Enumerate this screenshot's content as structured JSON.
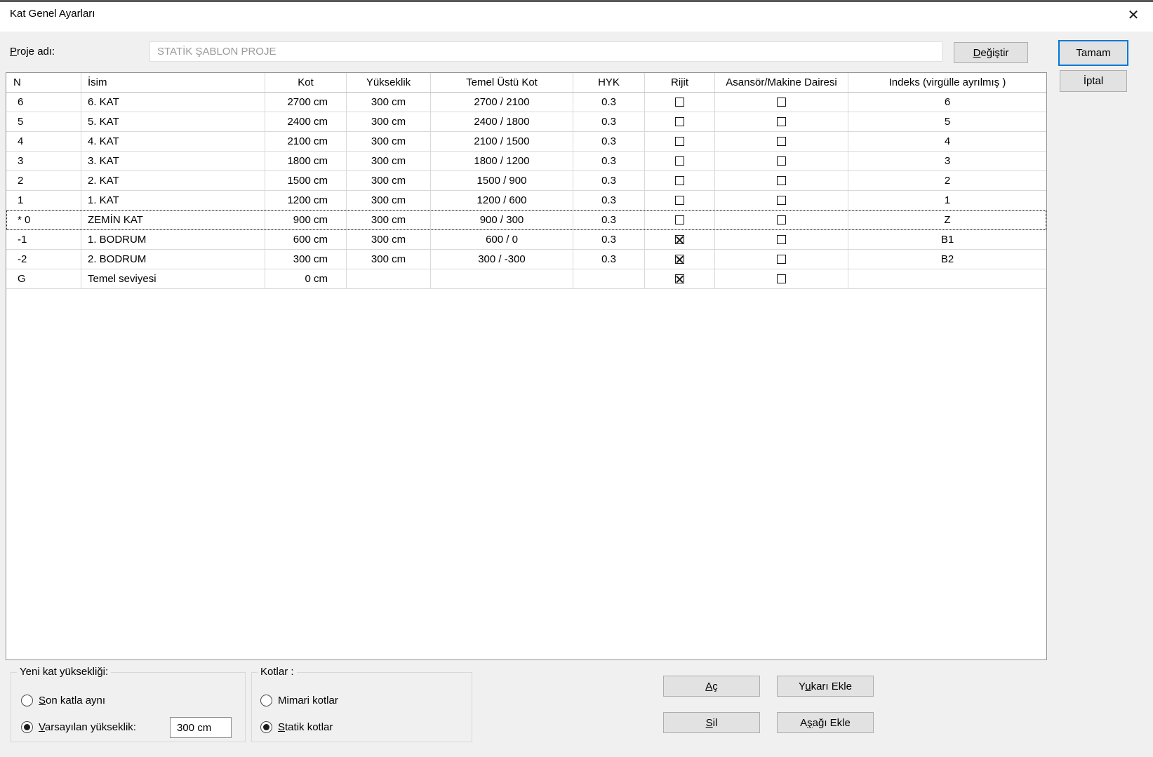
{
  "dialog": {
    "title": "Kat Genel Ayarları"
  },
  "icons": {
    "close": "✕"
  },
  "project": {
    "label": {
      "pre": "",
      "key": "P",
      "post": "roje adı:"
    },
    "value": "STATİK ŞABLON PROJE",
    "change_button": {
      "pre": "",
      "key": "D",
      "post": "eğiştir"
    }
  },
  "actions": {
    "ok": "Tamam",
    "cancel": "İptal"
  },
  "table": {
    "headers": [
      "N",
      "İsim",
      "Kot",
      "Yükseklik",
      "Temel Üstü Kot",
      "HYK",
      "Rijit",
      "Asansör/Makine Dairesi",
      "Indeks (virgülle ayrılmış )"
    ],
    "rows": [
      {
        "n": "6",
        "isim": "6. KAT",
        "kot": "2700 cm",
        "yukseklik": "300 cm",
        "temel": "2700 / 2100",
        "hyk": "0.3",
        "rijit": false,
        "asansor": false,
        "indeks": "6",
        "selected": false
      },
      {
        "n": "5",
        "isim": "5. KAT",
        "kot": "2400 cm",
        "yukseklik": "300 cm",
        "temel": "2400 / 1800",
        "hyk": "0.3",
        "rijit": false,
        "asansor": false,
        "indeks": "5",
        "selected": false
      },
      {
        "n": "4",
        "isim": "4. KAT",
        "kot": "2100 cm",
        "yukseklik": "300 cm",
        "temel": "2100 / 1500",
        "hyk": "0.3",
        "rijit": false,
        "asansor": false,
        "indeks": "4",
        "selected": false
      },
      {
        "n": "3",
        "isim": "3. KAT",
        "kot": "1800 cm",
        "yukseklik": "300 cm",
        "temel": "1800 / 1200",
        "hyk": "0.3",
        "rijit": false,
        "asansor": false,
        "indeks": "3",
        "selected": false
      },
      {
        "n": "2",
        "isim": "2. KAT",
        "kot": "1500 cm",
        "yukseklik": "300 cm",
        "temel": "1500 / 900",
        "hyk": "0.3",
        "rijit": false,
        "asansor": false,
        "indeks": "2",
        "selected": false
      },
      {
        "n": "1",
        "isim": "1. KAT",
        "kot": "1200 cm",
        "yukseklik": "300 cm",
        "temel": "1200 / 600",
        "hyk": "0.3",
        "rijit": false,
        "asansor": false,
        "indeks": "1",
        "selected": false
      },
      {
        "n": "* 0",
        "isim": "ZEMİN KAT",
        "kot": "900 cm",
        "yukseklik": "300 cm",
        "temel": "900 / 300",
        "hyk": "0.3",
        "rijit": false,
        "asansor": false,
        "indeks": "Z",
        "selected": true
      },
      {
        "n": "-1",
        "isim": "1. BODRUM",
        "kot": "600 cm",
        "yukseklik": "300 cm",
        "temel": "600 / 0",
        "hyk": "0.3",
        "rijit": true,
        "asansor": false,
        "indeks": "B1",
        "selected": false
      },
      {
        "n": "-2",
        "isim": "2. BODRUM",
        "kot": "300 cm",
        "yukseklik": "300 cm",
        "temel": "300 / -300",
        "hyk": "0.3",
        "rijit": true,
        "asansor": false,
        "indeks": "B2",
        "selected": false
      },
      {
        "n": "G",
        "isim": "Temel seviyesi",
        "kot": "0 cm",
        "yukseklik": "",
        "temel": "",
        "hyk": "",
        "rijit": true,
        "asansor": false,
        "indeks": "",
        "selected": false
      }
    ]
  },
  "footer": {
    "new_height_group": {
      "title": "Yeni kat yüksekliği:",
      "same_as_last": {
        "pre": "",
        "key": "S",
        "post": "on katla aynı"
      },
      "default_height": {
        "pre": "",
        "key": "V",
        "post": "arsayılan yükseklik:"
      },
      "height_value": "300 cm"
    },
    "kotlar_group": {
      "title": "Kotlar :",
      "mimari": {
        "pre": "Mimari kotlar",
        "key": "",
        "post": ""
      },
      "statik": {
        "pre": "",
        "key": "S",
        "post": "tatik kotlar"
      }
    },
    "buttons": {
      "open": {
        "pre": "",
        "key": "A",
        "post": "ç"
      },
      "delete": {
        "pre": "",
        "key": "S",
        "post": "il"
      },
      "add_above": {
        "pre": "Y",
        "key": "u",
        "post": "karı Ekle"
      },
      "add_below": {
        "pre": "A",
        "key": "ş",
        "post": "ağı Ekle"
      }
    }
  },
  "colors": {
    "accent": "#0078d7",
    "dialog_bg": "#f0f0f0",
    "titlebar_bg": "#ffffff"
  }
}
